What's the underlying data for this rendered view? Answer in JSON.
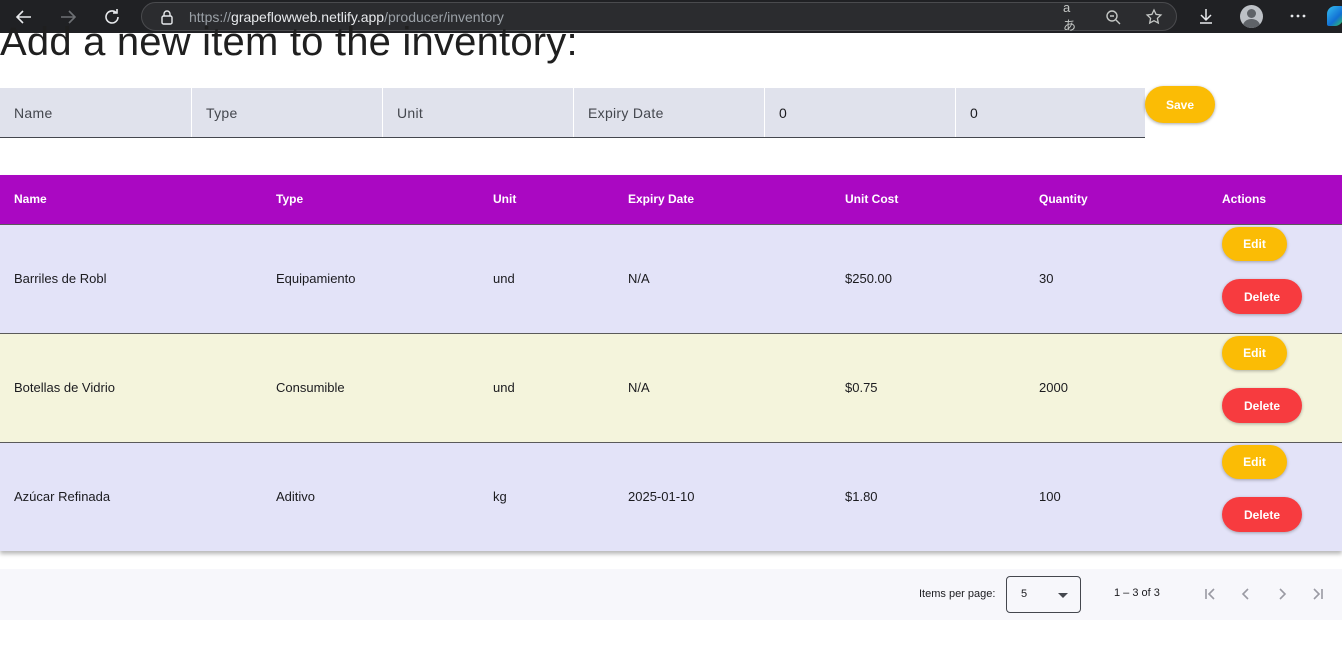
{
  "browser": {
    "url_prefix": "https://",
    "url_domain": "grapeflowweb.netlify.app",
    "url_path": "/producer/inventory",
    "read_aloud_glyph": "aあ"
  },
  "page": {
    "title": "Add a new item to the inventory:"
  },
  "form": {
    "fields": [
      {
        "placeholder": "Name",
        "value": ""
      },
      {
        "placeholder": "Type",
        "value": ""
      },
      {
        "placeholder": "Unit",
        "value": ""
      },
      {
        "placeholder": "Expiry Date",
        "value": ""
      },
      {
        "placeholder": "",
        "value": "0"
      },
      {
        "placeholder": "",
        "value": "0"
      }
    ],
    "save_label": "Save"
  },
  "table": {
    "columns": [
      "Name",
      "Type",
      "Unit",
      "Expiry Date",
      "Unit Cost",
      "Quantity",
      "Actions"
    ],
    "rows": [
      {
        "name": "Barriles de Robl",
        "type": "Equipamiento",
        "unit": "und",
        "expiry": "N/A",
        "cost": "$250.00",
        "qty": "30",
        "bg": "#e3e3f8"
      },
      {
        "name": "Botellas de Vidrio",
        "type": "Consumible",
        "unit": "und",
        "expiry": "N/A",
        "cost": "$0.75",
        "qty": "2000",
        "bg": "#f4f4dc"
      },
      {
        "name": "Azúcar Refinada",
        "type": "Aditivo",
        "unit": "kg",
        "expiry": "2025-01-10",
        "cost": "$1.80",
        "qty": "100",
        "bg": "#e3e3f8"
      }
    ],
    "edit_label": "Edit",
    "delete_label": "Delete"
  },
  "paginator": {
    "items_per_page_label": "Items per page:",
    "page_size": "5",
    "range_label": "1 – 3 of 3"
  },
  "colors": {
    "header_bg": "#aa08c2",
    "edit_btn": "#fbbc05",
    "delete_btn": "#f73b3f",
    "save_btn": "#fbbc05"
  }
}
